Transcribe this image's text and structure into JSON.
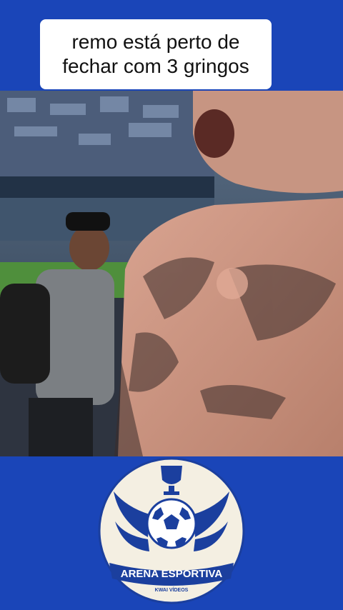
{
  "caption": {
    "text": "remo está perto de\nfechar com 3 gringos"
  },
  "video": {
    "description_icon": "video-frame"
  },
  "logo": {
    "title": "ARENA ESPORTIVA",
    "subtitle": "KWAI VÍDEOS"
  },
  "colors": {
    "background": "#1a45b8",
    "caption_bg": "#ffffff",
    "logo_blue": "#1b3f9e",
    "logo_cream": "#f4efe2"
  }
}
